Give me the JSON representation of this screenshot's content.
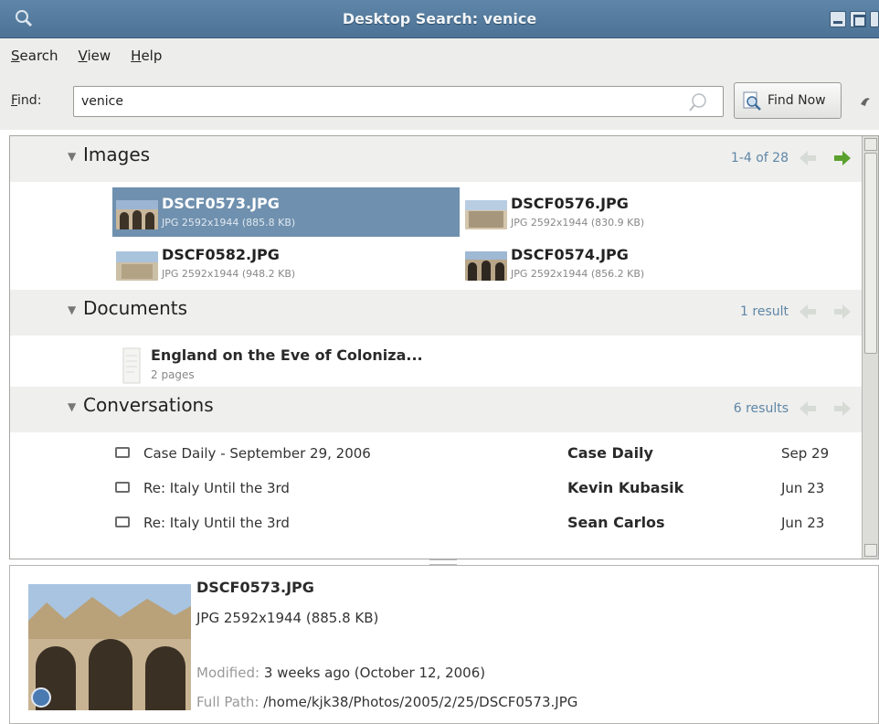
{
  "window": {
    "title": "Desktop Search: venice"
  },
  "menu": [
    "Search",
    "View",
    "Help"
  ],
  "find": {
    "label": "Find:",
    "value": "venice",
    "button_label": "Find Now"
  },
  "categories": {
    "images": {
      "name": "Images",
      "count": "1-4 of 28"
    },
    "documents": {
      "name": "Documents",
      "count": "1 result"
    },
    "conversations": {
      "name": "Conversations",
      "count": "6 results"
    }
  },
  "images": [
    {
      "name": "DSCF0573.JPG",
      "meta": "JPG 2592x1944 (885.8 KB)",
      "selected": true
    },
    {
      "name": "DSCF0576.JPG",
      "meta": "JPG 2592x1944 (830.9 KB)",
      "selected": false
    },
    {
      "name": "DSCF0582.JPG",
      "meta": "JPG 2592x1944 (948.2 KB)",
      "selected": false
    },
    {
      "name": "DSCF0574.JPG",
      "meta": "JPG 2592x1944 (856.2 KB)",
      "selected": false
    }
  ],
  "documents": [
    {
      "title": "England on the Eve of Coloniza...",
      "pages": "2 pages"
    }
  ],
  "conversations": [
    {
      "subject": "Case Daily - September 29, 2006",
      "sender": "Case Daily",
      "date": "Sep 29"
    },
    {
      "subject": "Re: Italy Until the 3rd",
      "sender": "Kevin Kubasik",
      "date": "Jun 23"
    },
    {
      "subject": "Re: Italy Until the 3rd",
      "sender": "Sean Carlos",
      "date": "Jun 23"
    }
  ],
  "preview": {
    "name": "DSCF0573.JPG",
    "meta": "JPG 2592x1944 (885.8 KB)",
    "modified_label": "Modified:",
    "modified_value": "3 weeks ago (October 12, 2006)",
    "path_label": "Full Path:",
    "path_value": "/home/kjk38/Photos/2005/2/25/DSCF0573.JPG"
  },
  "colors": {
    "titlebar": "#4f7699",
    "selection": "#6f90ae",
    "count_text": "#5e86a6"
  }
}
